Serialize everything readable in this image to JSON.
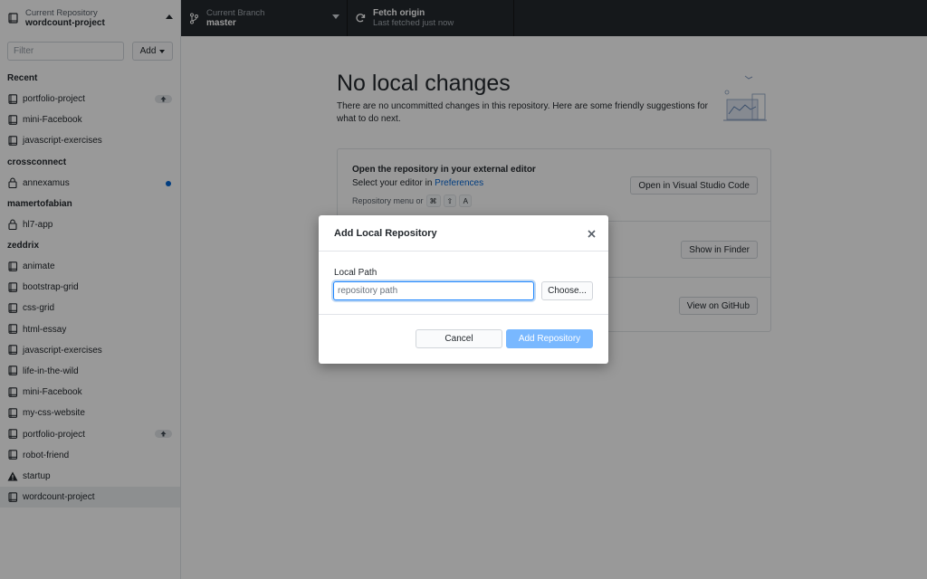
{
  "toolbar": {
    "repository": {
      "sub": "Current Repository",
      "main": "wordcount-project"
    },
    "branch": {
      "sub": "Current Branch",
      "main": "master"
    },
    "fetch": {
      "main": "Fetch origin",
      "sub": "Last fetched just now"
    }
  },
  "sidebar": {
    "filter_placeholder": "Filter",
    "add_label": "Add",
    "groups": [
      {
        "title": "Recent",
        "items": [
          {
            "name": "portfolio-project",
            "icon": "repo-icon",
            "badge": "arrow-up-icon"
          },
          {
            "name": "mini-Facebook",
            "icon": "repo-icon"
          },
          {
            "name": "javascript-exercises",
            "icon": "repo-icon"
          }
        ]
      },
      {
        "title": "crossconnect",
        "items": [
          {
            "name": "annexamus",
            "icon": "lock-icon",
            "indicator": "blue-dot"
          }
        ]
      },
      {
        "title": "mamertofabian",
        "items": [
          {
            "name": "hl7-app",
            "icon": "lock-icon"
          }
        ]
      },
      {
        "title": "zeddrix",
        "items": [
          {
            "name": "animate",
            "icon": "repo-icon"
          },
          {
            "name": "bootstrap-grid",
            "icon": "repo-icon"
          },
          {
            "name": "css-grid",
            "icon": "repo-icon"
          },
          {
            "name": "html-essay",
            "icon": "repo-icon"
          },
          {
            "name": "javascript-exercises",
            "icon": "repo-icon"
          },
          {
            "name": "life-in-the-wild",
            "icon": "repo-icon"
          },
          {
            "name": "mini-Facebook",
            "icon": "repo-icon"
          },
          {
            "name": "my-css-website",
            "icon": "repo-icon"
          },
          {
            "name": "portfolio-project",
            "icon": "repo-icon",
            "badge": "arrow-up-icon"
          },
          {
            "name": "robot-friend",
            "icon": "repo-icon"
          },
          {
            "name": "startup",
            "icon": "warning-icon"
          },
          {
            "name": "wordcount-project",
            "icon": "repo-icon",
            "selected": true
          }
        ]
      }
    ]
  },
  "main": {
    "title": "No local changes",
    "description": "There are no uncommitted changes in this repository. Here are some friendly suggestions for what to do next.",
    "suggestions": [
      {
        "title": "Open the repository in your external editor",
        "desc_prefix": "Select your editor in ",
        "desc_link": "Preferences",
        "menu_prefix": "Repository menu or",
        "keys": [
          "⌘",
          "⇧",
          "A"
        ],
        "button": "Open in Visual Studio Code"
      },
      {
        "button": "Show in Finder"
      },
      {
        "button": "View on GitHub"
      }
    ]
  },
  "modal": {
    "title": "Add Local Repository",
    "local_path_label": "Local Path",
    "path_placeholder": "repository path",
    "choose_label": "Choose...",
    "cancel_label": "Cancel",
    "add_label": "Add Repository"
  }
}
